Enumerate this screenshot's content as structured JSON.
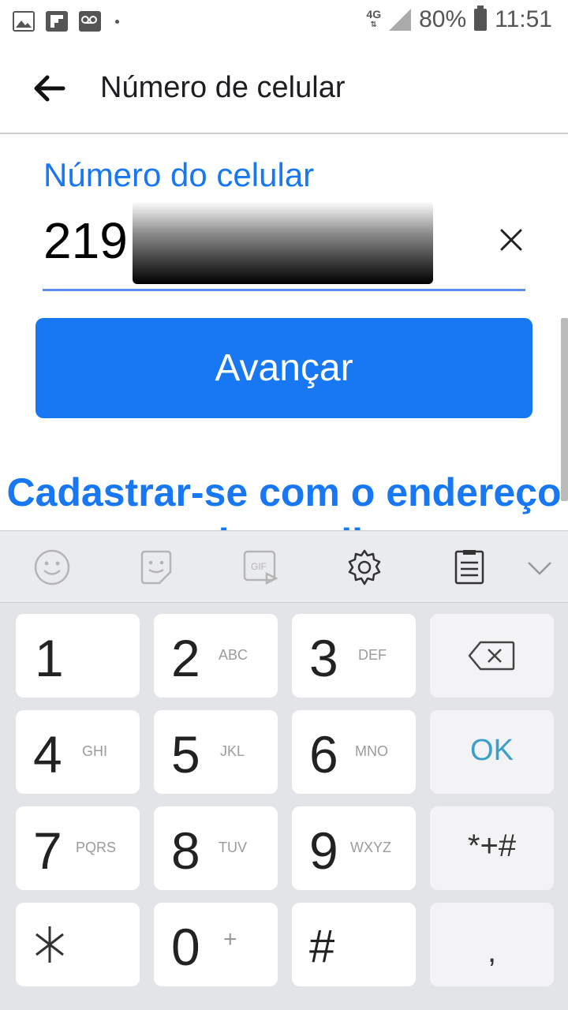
{
  "status_bar": {
    "network": "4G",
    "battery": "80%",
    "time": "11:51"
  },
  "app_bar": {
    "title": "Número de celular"
  },
  "form": {
    "field_label": "Número do celular",
    "field_value": "219",
    "submit_label": "Avançar",
    "link_text": "Cadastrar-se com o endereço de email"
  },
  "keyboard_toolbar": {
    "icons": [
      "emoji-icon",
      "sticker-icon",
      "gif-icon",
      "settings-gear-icon",
      "clipboard-icon",
      "chevron-down-icon"
    ]
  },
  "keypad": {
    "k1": {
      "num": "1",
      "sub": ""
    },
    "k2": {
      "num": "2",
      "sub": "ABC"
    },
    "k3": {
      "num": "3",
      "sub": "DEF"
    },
    "k4": {
      "num": "4",
      "sub": "GHI"
    },
    "k5": {
      "num": "5",
      "sub": "JKL"
    },
    "k6": {
      "num": "6",
      "sub": "MNO"
    },
    "k7": {
      "num": "7",
      "sub": "PQRS"
    },
    "k8": {
      "num": "8",
      "sub": "TUV"
    },
    "k9": {
      "num": "9",
      "sub": "WXYZ"
    },
    "k0": {
      "num": "0",
      "sub": "+"
    },
    "star": "⁎",
    "hash": "#",
    "ok": "OK",
    "symbols": "*+#",
    "comma": ","
  },
  "colors": {
    "accent": "#1877f2",
    "ok_text": "#3aa0c8",
    "keyboard_bg": "#e3e4e8"
  }
}
